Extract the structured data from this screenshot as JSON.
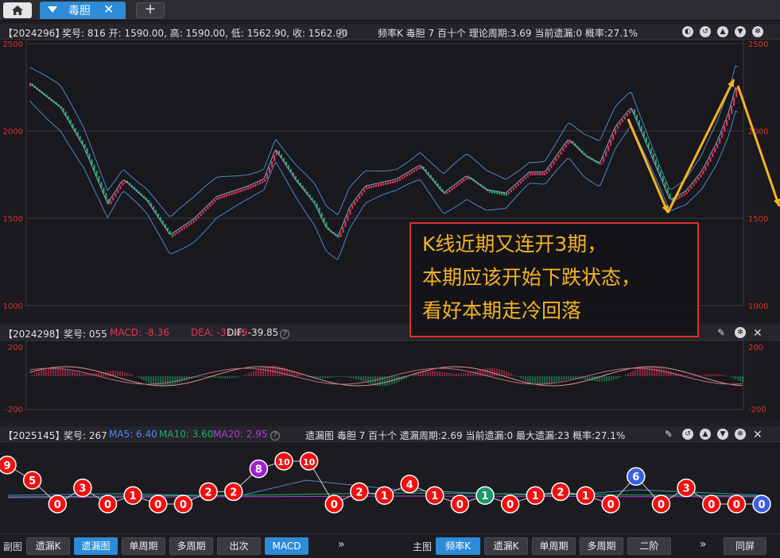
{
  "tab": {
    "label": "毒胆"
  },
  "main": {
    "code": "【2024296】",
    "info": "奖号: 816  开: 1590.00, 高: 1590.00, 低: 1562.90, 收: 1562.90",
    "right_info": "频率K   毒胆   7   百十个   理论周期:3.69   当前遗漏:0   概率:27.1%",
    "y_ticks": [
      "2500",
      "2000",
      "1500",
      "1000"
    ]
  },
  "macd": {
    "code": "【2024298】",
    "info_prefix": "奖号: 055",
    "macd": "MACD: -8.36",
    "dea": "DEA: -31.49",
    "dif": "DIF: -39.85",
    "y_ticks": [
      "200",
      "-200"
    ]
  },
  "miss": {
    "code": "【2025145】",
    "info_prefix": "奖号: 267",
    "ma5": "MA5: 6.40",
    "ma10": "MA10: 3.60",
    "ma20": "MA20: 2.95",
    "right_info": "遗漏图   毒胆   7   百十个   遗漏周期:2.69   当前遗漏:0   最大遗漏:23   概率:27.1%",
    "balls": [
      "9",
      "5",
      "0",
      "3",
      "0",
      "1",
      "0",
      "0",
      "2",
      "2",
      "8",
      "10",
      "10",
      "0",
      "2",
      "1",
      "4",
      "1",
      "0",
      "1",
      "0",
      "1",
      "2",
      "1",
      "0",
      "6",
      "0",
      "3",
      "0",
      "0",
      "0"
    ]
  },
  "annotation": [
    "K线近期又连开3期，",
    "本期应该开始下跌状态，",
    "看好本期走冷回落"
  ],
  "bottom": {
    "left_label": "副图",
    "left_buttons": [
      "遗漏K",
      "遗漏图",
      "单周期",
      "多周期",
      "出次",
      "MACD"
    ],
    "right_label": "主图",
    "right_buttons": [
      "频率K",
      "遗漏K",
      "单周期",
      "多周期",
      "二阶"
    ],
    "more": "»",
    "same_screen": "同屏"
  },
  "colors": {
    "up": "#e8335a",
    "down": "#1fae6a",
    "band": "#4f86c6",
    "accent": "#2d8bd8",
    "arrow": "#f5b324"
  }
}
